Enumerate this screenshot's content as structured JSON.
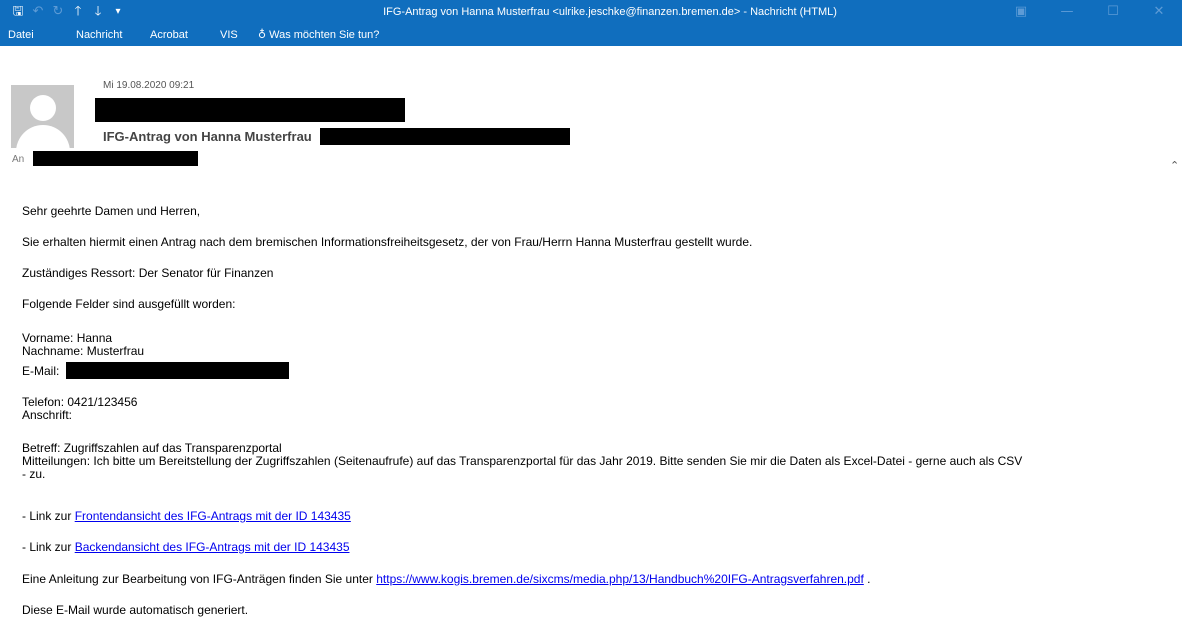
{
  "titlebar": {
    "icons": [
      "save-icon",
      "undo-icon",
      "redo-icon",
      "arrow-up-icon",
      "arrow-down-icon",
      "customize-icon"
    ],
    "title": "IFG-Antrag von Hanna Musterfrau <ulrike.jeschke@finanzen.bremen.de>  -  Nachricht (HTML)",
    "controls": [
      "ribbon-display-icon",
      "minimize-icon",
      "maximize-icon",
      "close-icon"
    ]
  },
  "ribbon": {
    "tabs": [
      "Datei",
      "Nachricht",
      "Acrobat",
      "VIS"
    ],
    "tell_me": "Was möchten Sie tun?"
  },
  "header": {
    "date": "Mi 19.08.2020 09:21",
    "subject": "IFG-Antrag von Hanna Musterfrau",
    "to_label": "An"
  },
  "body": {
    "greeting": "Sehr geehrte Damen und Herren,",
    "intro": "Sie erhalten hiermit einen Antrag nach dem bremischen Informationsfreiheitsgesetz, der von Frau/Herrn Hanna Musterfrau gestellt wurde.",
    "ressort": "Zuständiges Ressort: Der Senator für Finanzen",
    "fields_intro": "Folgende Felder sind ausgefüllt worden:",
    "vorname": "Vorname: Hanna",
    "nachname": "Nachname: Musterfrau",
    "email_label": "E-Mail:",
    "telefon": "Telefon: 0421/123456",
    "anschrift": "Anschrift:",
    "betreff": "Betreff: Zugriffszahlen auf das Transparenzportal",
    "mitteilungen_1": "Mitteilungen: Ich bitte um Bereitstellung der Zugriffszahlen (Seitenaufrufe) auf das Transparenzportal für das Jahr 2019. Bitte senden Sie mir die Daten als Excel-Datei - gerne auch als CSV",
    "mitteilungen_2": "- zu.",
    "link1_prefix": "- Link zur ",
    "link1_text": "Frontendansicht des IFG-Antrags mit der ID 143435",
    "link2_prefix": "- Link zur ",
    "link2_text": "Backendansicht des IFG-Antrags mit der ID 143435",
    "anleitung_prefix": "Eine Anleitung zur Bearbeitung von IFG-Anträgen finden Sie unter ",
    "anleitung_link": "https://www.kogis.bremen.de/sixcms/media.php/13/Handbuch%20IFG-Antragsverfahren.pdf",
    "anleitung_suffix": " .",
    "footer": "Diese E-Mail wurde automatisch generiert."
  },
  "colors": {
    "titlebar": "#106ebe",
    "link": "#0000ee"
  }
}
